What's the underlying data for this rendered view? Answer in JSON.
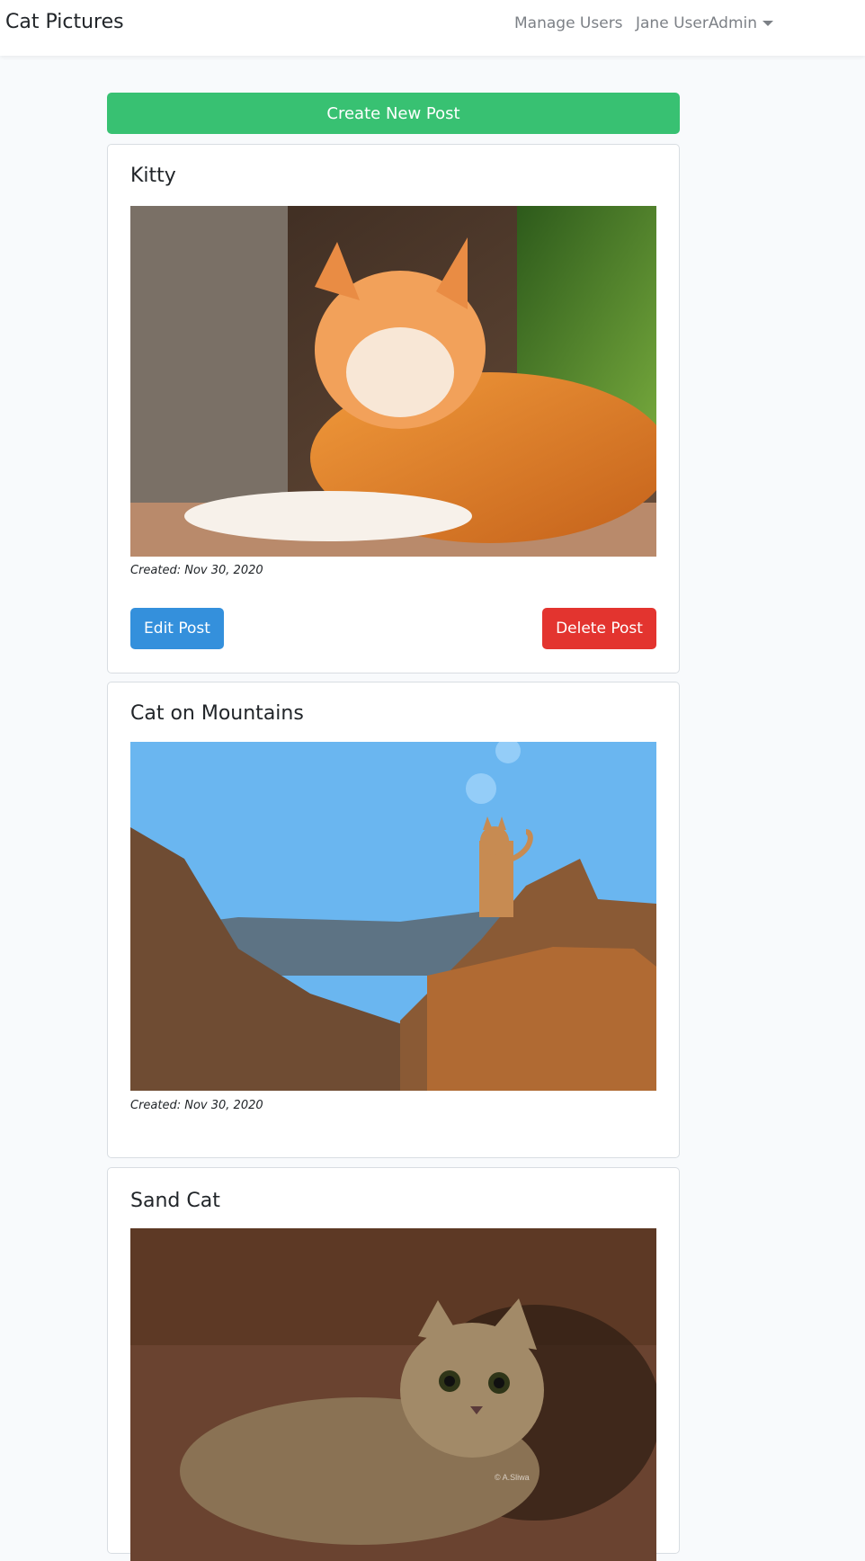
{
  "navbar": {
    "brand": "Cat Pictures",
    "manage_users": "Manage Users",
    "user_menu": "Jane UserAdmin"
  },
  "create_button": "Create New Post",
  "posts": [
    {
      "title": "Kitty",
      "created": "Created: Nov 30, 2020",
      "edit_label": "Edit Post",
      "delete_label": "Delete Post"
    },
    {
      "title": "Cat on Mountains",
      "created": "Created: Nov 30, 2020"
    },
    {
      "title": "Sand Cat",
      "watermark": "© A.Sliwa"
    }
  ],
  "colors": {
    "create": "#38c172",
    "edit": "#3490dc",
    "delete": "#e3342f"
  }
}
